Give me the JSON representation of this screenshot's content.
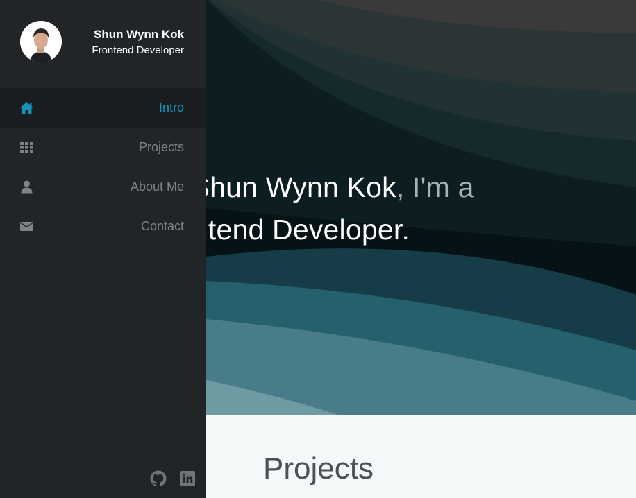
{
  "profile": {
    "name": "Shun Wynn Kok",
    "role": "Frontend Developer"
  },
  "nav": {
    "items": [
      {
        "label": "Intro",
        "icon": "home-icon",
        "active": true
      },
      {
        "label": "Projects",
        "icon": "grid-icon",
        "active": false
      },
      {
        "label": "About Me",
        "icon": "user-icon",
        "active": false
      },
      {
        "label": "Contact",
        "icon": "envelope-icon",
        "active": false
      }
    ]
  },
  "hero": {
    "line1_prefix": "n Shun Wynn Kok",
    "line1_suffix": ", I'm a",
    "line2": "rontend Developer."
  },
  "projects": {
    "heading": "Projects"
  },
  "social": {
    "github_icon": "github-icon",
    "linkedin_icon": "linkedin-icon"
  },
  "colors": {
    "sidebar_bg": "#212528",
    "active_bg": "#1a1d20",
    "accent": "#1493b9",
    "nav_text": "#7d8388",
    "section_bg": "#f4f8f9"
  }
}
